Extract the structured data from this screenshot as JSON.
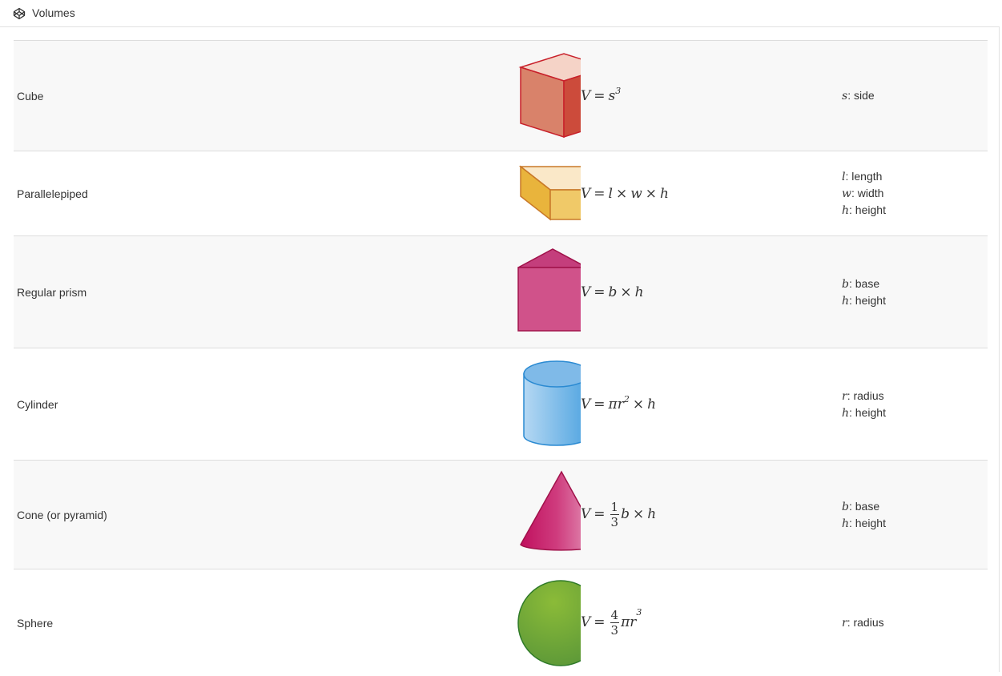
{
  "header": {
    "title": "Volumes",
    "icon": "codepen-icon"
  },
  "rows": [
    {
      "name": "Cube",
      "formula": {
        "lhs": "V",
        "rhs": "s",
        "power": "3"
      },
      "vars": [
        {
          "sym": "s",
          "desc": ": side"
        }
      ]
    },
    {
      "name": "Parallelepiped",
      "formula": {
        "lhs": "V",
        "a": "l",
        "b": "w",
        "c": "h"
      },
      "vars": [
        {
          "sym": "l",
          "desc": ": length"
        },
        {
          "sym": "w",
          "desc": ": width"
        },
        {
          "sym": "h",
          "desc": ": height"
        }
      ]
    },
    {
      "name": "Regular prism",
      "formula": {
        "lhs": "V",
        "a": "b",
        "b": "h"
      },
      "vars": [
        {
          "sym": "b",
          "desc": ": base"
        },
        {
          "sym": "h",
          "desc": ": height"
        }
      ]
    },
    {
      "name": "Cylinder",
      "formula": {
        "lhs": "V",
        "pi": "π",
        "r": "r",
        "power": "2",
        "h": "h"
      },
      "vars": [
        {
          "sym": "r",
          "desc": ": radius"
        },
        {
          "sym": "h",
          "desc": ": height"
        }
      ]
    },
    {
      "name": "Cone (or pyramid)",
      "formula": {
        "lhs": "V",
        "num": "1",
        "den": "3",
        "b": "b",
        "h": "h"
      },
      "vars": [
        {
          "sym": "b",
          "desc": ": base"
        },
        {
          "sym": "h",
          "desc": ": height"
        }
      ]
    },
    {
      "name": "Sphere",
      "formula": {
        "lhs": "V",
        "num": "4",
        "den": "3",
        "pi": "π",
        "r": "r",
        "power": "3"
      },
      "vars": [
        {
          "sym": "r",
          "desc": ": radius"
        }
      ]
    }
  ],
  "ops": {
    "eq": "=",
    "times": "×"
  },
  "colors": {
    "cube": "#d05a48",
    "parallelepiped": "#f0c865",
    "prism": "#d0528a",
    "cylinder": "#6fb0e4",
    "cone": "#c51f6a",
    "sphere": "#7aa93c"
  }
}
